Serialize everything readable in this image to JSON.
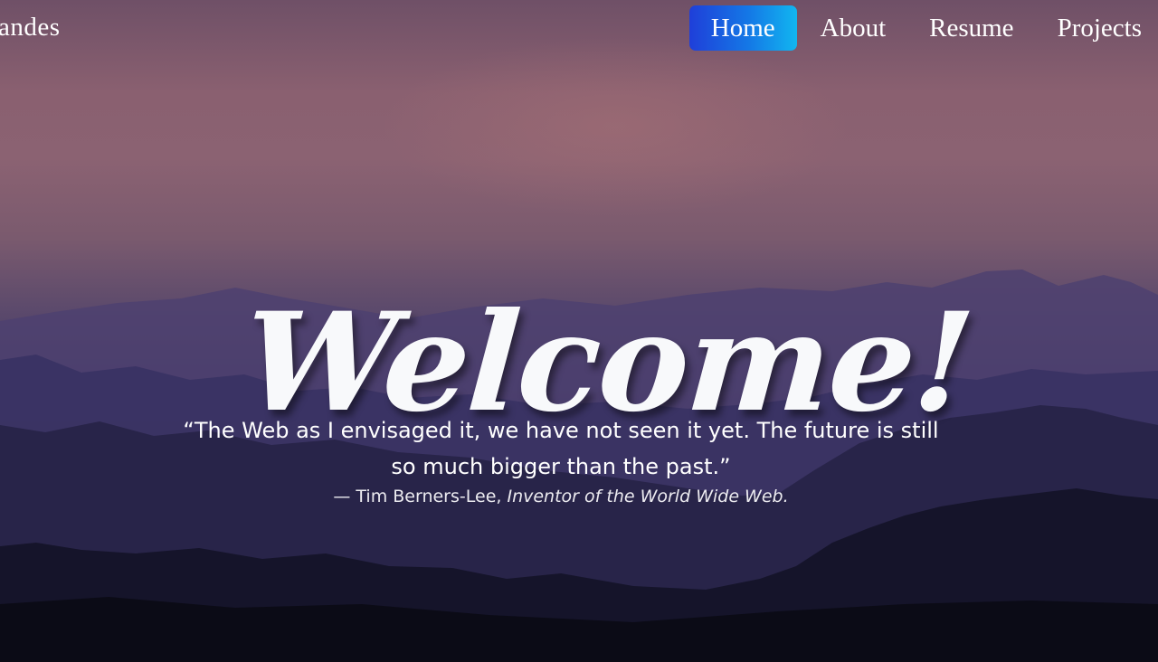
{
  "navbar": {
    "brand": "andes",
    "links": [
      {
        "label": "Home",
        "active": true
      },
      {
        "label": "About",
        "active": false
      },
      {
        "label": "Resume",
        "active": false
      },
      {
        "label": "Projects",
        "active": false
      }
    ],
    "active_gradient": [
      "#1f3fd9",
      "#12b6f0"
    ]
  },
  "hero": {
    "headline": "Welcome!",
    "quote": "“The Web as I envisaged it, we have not seen it yet. The future is still so much bigger than the past.”",
    "attribution_prefix": "— Tim Berners-Lee,",
    "attribution_role": "Inventor of the World Wide Web.",
    "background_colors": {
      "sky_top": "#6f5067",
      "sky_mid": "#8b6272",
      "mountains_far": "#4a3f6d",
      "mountains_near": "#141326"
    }
  }
}
